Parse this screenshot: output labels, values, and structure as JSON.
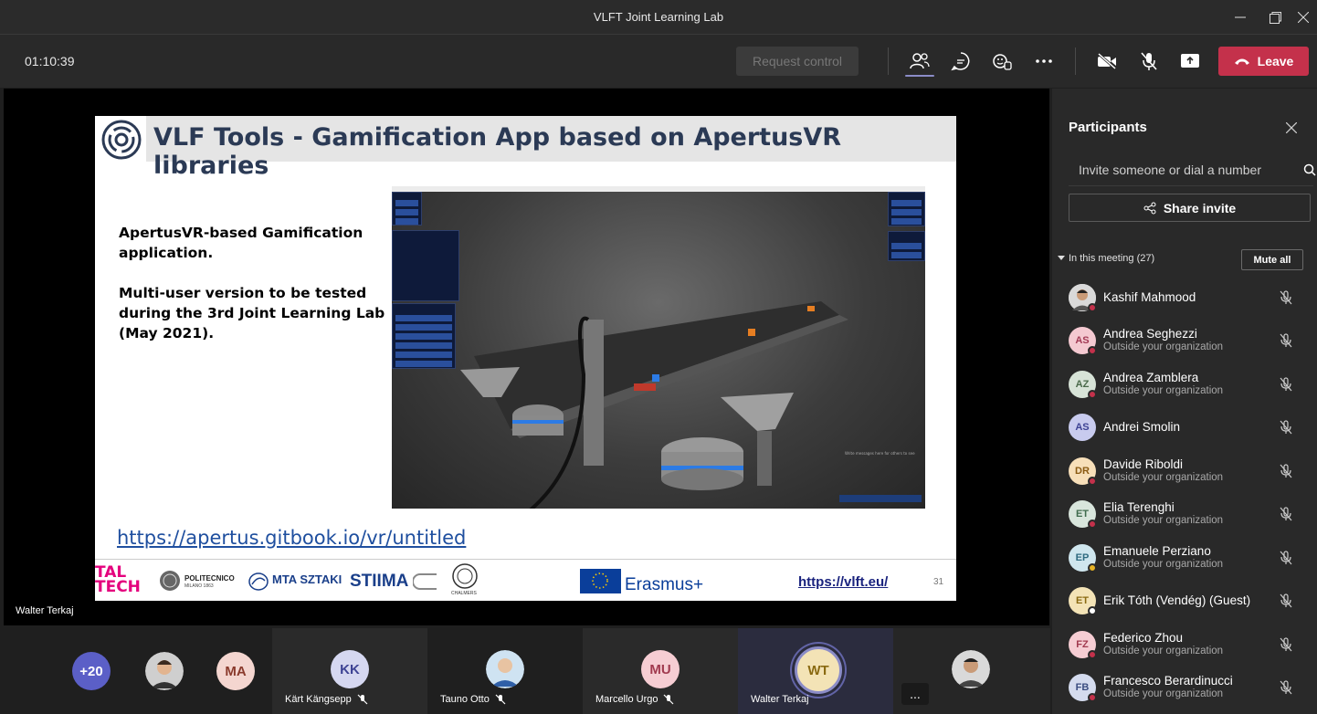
{
  "window": {
    "title": "VLFT Joint Learning Lab"
  },
  "toolbar": {
    "timer": "01:10:39",
    "request_control": "Request control",
    "leave": "Leave"
  },
  "presenter": {
    "name": "Walter Terkaj"
  },
  "slide": {
    "title": "VLF Tools - Gamification App based on ApertusVR libraries",
    "line1": "ApertusVR-based Gamification",
    "line2": "application.",
    "line3": "Multi-user version to be tested",
    "line4": "during the 3rd Joint Learning Lab",
    "line5": "(May 2021).",
    "link": "https://apertus.gitbook.io/vr/untitled",
    "vlft_link": "https://vlft.eu/",
    "page": "31",
    "app_message": "Write messages here for others to see",
    "logos": {
      "taltech_1": "TAL",
      "taltech_2": "TECH",
      "polimi": "POLITECNICO",
      "polimi_sub": "MILANO 1863",
      "sztaki": "MTA SZTAKI",
      "stiima": "STIIMA",
      "chalmers": "CHALMERS",
      "erasmus": "Erasmus+"
    }
  },
  "panel": {
    "title": "Participants",
    "invite_placeholder": "Invite someone or dial a number",
    "share_invite": "Share invite",
    "section": "In this meeting (27)",
    "mute_all": "Mute all",
    "participants": [
      {
        "name": "Kashif Mahmood",
        "sub": "",
        "initials": "",
        "status": "#c4314b",
        "avatar_bg": "#d9d9d9"
      },
      {
        "name": "Andrea Seghezzi",
        "sub": "Outside your organization",
        "initials": "AS",
        "status": "#c4314b",
        "avatar_bg": "#f4c9d1",
        "fg": "#a23a55"
      },
      {
        "name": "Andrea Zamblera",
        "sub": "Outside your organization",
        "initials": "AZ",
        "status": "#c4314b",
        "avatar_bg": "#d7e3d7",
        "fg": "#4a6a4a"
      },
      {
        "name": "Andrei Smolin",
        "sub": "",
        "initials": "AS",
        "status": "",
        "avatar_bg": "#c8cbee",
        "fg": "#3e4394"
      },
      {
        "name": "Davide Riboldi",
        "sub": "Outside your organization",
        "initials": "DR",
        "status": "#c4314b",
        "avatar_bg": "#f7dfb9",
        "fg": "#8a5a12"
      },
      {
        "name": "Elia Terenghi",
        "sub": "Outside your organization",
        "initials": "ET",
        "status": "#c4314b",
        "avatar_bg": "#d8e5dc",
        "fg": "#3f6b4d"
      },
      {
        "name": "Emanuele Perziano",
        "sub": "Outside your organization",
        "initials": "EP",
        "status": "#e6b325",
        "avatar_bg": "#cfe6ee",
        "fg": "#2f6b80"
      },
      {
        "name": "Erik Tóth (Vendég) (Guest)",
        "sub": "",
        "initials": "ET",
        "status": "#ffffff",
        "avatar_bg": "#f3e3b6",
        "fg": "#8a6a12"
      },
      {
        "name": "Federico Zhou",
        "sub": "Outside your organization",
        "initials": "FZ",
        "status": "#c4314b",
        "avatar_bg": "#f6cdd3",
        "fg": "#a13a4f"
      },
      {
        "name": "Francesco Berardinucci",
        "sub": "Outside your organization",
        "initials": "FB",
        "status": "#c4314b",
        "avatar_bg": "#d4dbee",
        "fg": "#3b4d80"
      }
    ]
  },
  "strip": {
    "overflow_count": "+20",
    "tiles": [
      {
        "initials": "MA",
        "name": ""
      },
      {
        "initials": "KK",
        "name": "Kärt Kängsepp"
      },
      {
        "initials": "",
        "name": "Tauno Otto"
      },
      {
        "initials": "MU",
        "name": "Marcello Urgo"
      },
      {
        "initials": "WT",
        "name": "Walter Terkaj"
      }
    ],
    "more": "..."
  }
}
